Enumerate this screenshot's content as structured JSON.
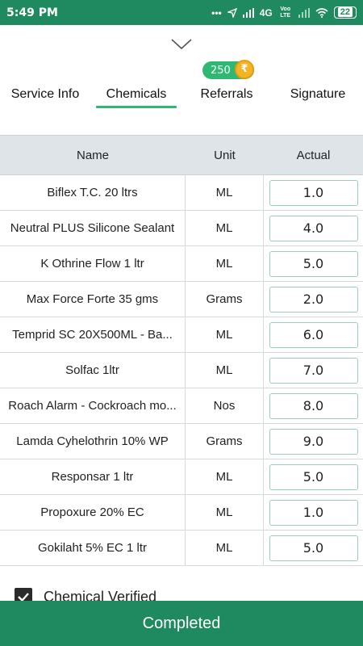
{
  "status_bar": {
    "time": "5:49 PM",
    "network": "4G",
    "network_sub": "Voo LTE",
    "battery": "22"
  },
  "referral_badge": {
    "points": "250",
    "currency_symbol": "₹"
  },
  "tabs": [
    {
      "label": "Service Info",
      "active": false
    },
    {
      "label": "Chemicals",
      "active": true
    },
    {
      "label": "Referrals",
      "active": false
    },
    {
      "label": "Signature",
      "active": false
    }
  ],
  "table": {
    "headers": {
      "name": "Name",
      "unit": "Unit",
      "actual": "Actual"
    },
    "rows": [
      {
        "name": "Biflex T.C. 20 ltrs",
        "unit": "ML",
        "actual": "1.0"
      },
      {
        "name": "Neutral PLUS Silicone Sealant",
        "unit": "ML",
        "actual": "4.0"
      },
      {
        "name": "K Othrine Flow 1 ltr",
        "unit": "ML",
        "actual": "5.0"
      },
      {
        "name": "Max Force Forte 35 gms",
        "unit": "Grams",
        "actual": "2.0"
      },
      {
        "name": "Temprid SC 20X500ML - Ba...",
        "unit": "ML",
        "actual": "6.0"
      },
      {
        "name": "Solfac 1ltr",
        "unit": "ML",
        "actual": "7.0"
      },
      {
        "name": "Roach Alarm - Cockroach mo...",
        "unit": "Nos",
        "actual": "8.0"
      },
      {
        "name": "Lamda Cyhelothrin 10% WP",
        "unit": "Grams",
        "actual": "9.0"
      },
      {
        "name": "Responsar 1 ltr",
        "unit": "ML",
        "actual": "5.0"
      },
      {
        "name": "Propoxure 20% EC",
        "unit": "ML",
        "actual": "1.0"
      },
      {
        "name": "Gokilaht 5% EC 1 ltr",
        "unit": "ML",
        "actual": "5.0"
      }
    ]
  },
  "verify": {
    "label": "Chemical Verified",
    "checked": true
  },
  "bottom_button": {
    "label": "Completed"
  },
  "colors": {
    "primary": "#1f8a5f",
    "accent": "#2eb872",
    "header_bg": "#dfe4e8",
    "coin": "#f5b423"
  }
}
